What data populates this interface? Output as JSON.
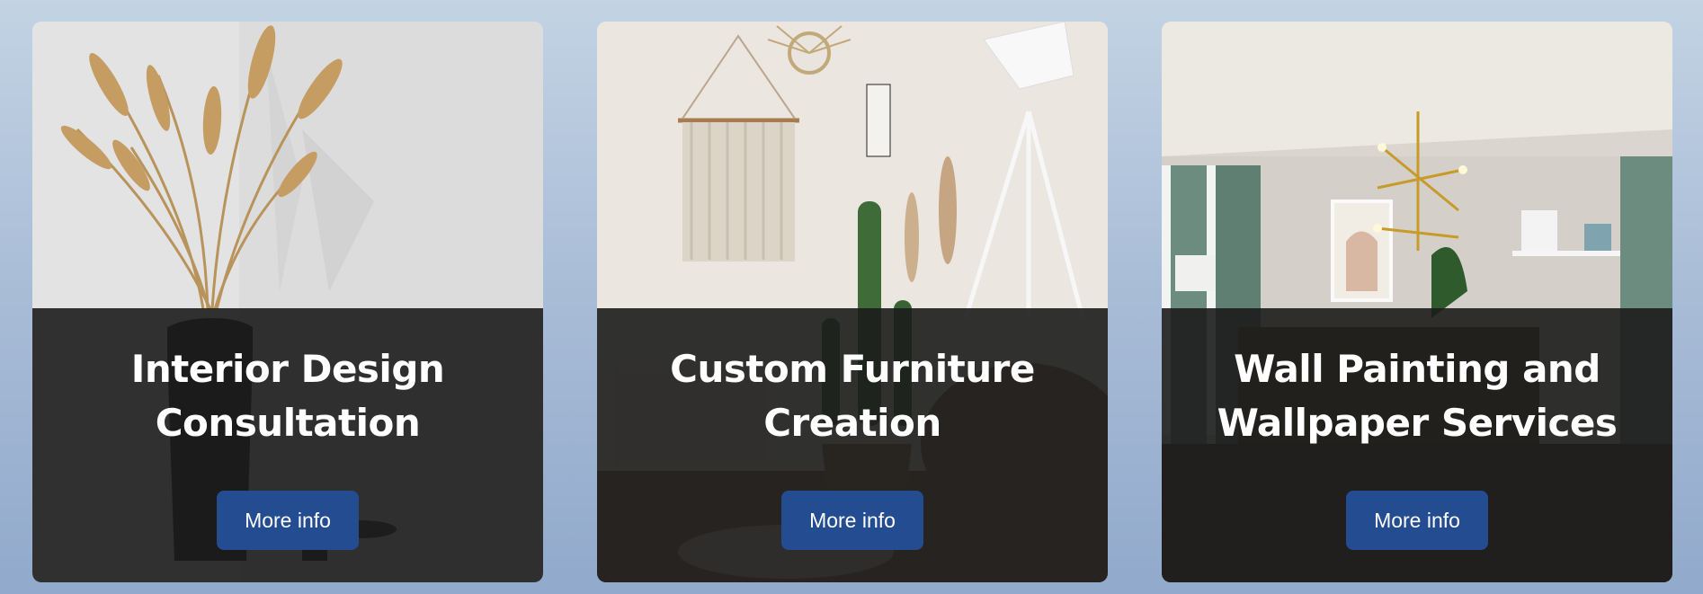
{
  "cards": [
    {
      "title_line1": "Interior Design",
      "title_line2": "Consultation",
      "button_label": "More info"
    },
    {
      "title_line1": "Custom Furniture",
      "title_line2": "Creation",
      "button_label": "More info"
    },
    {
      "title_line1": "Wall Painting and",
      "title_line2": "Wallpaper Services",
      "button_label": "More info"
    }
  ],
  "colors": {
    "button_bg": "#234c91",
    "overlay": "#1c1c1c",
    "page_gradient_top": "#c3d3e4",
    "page_gradient_bottom": "#91a9cc"
  }
}
